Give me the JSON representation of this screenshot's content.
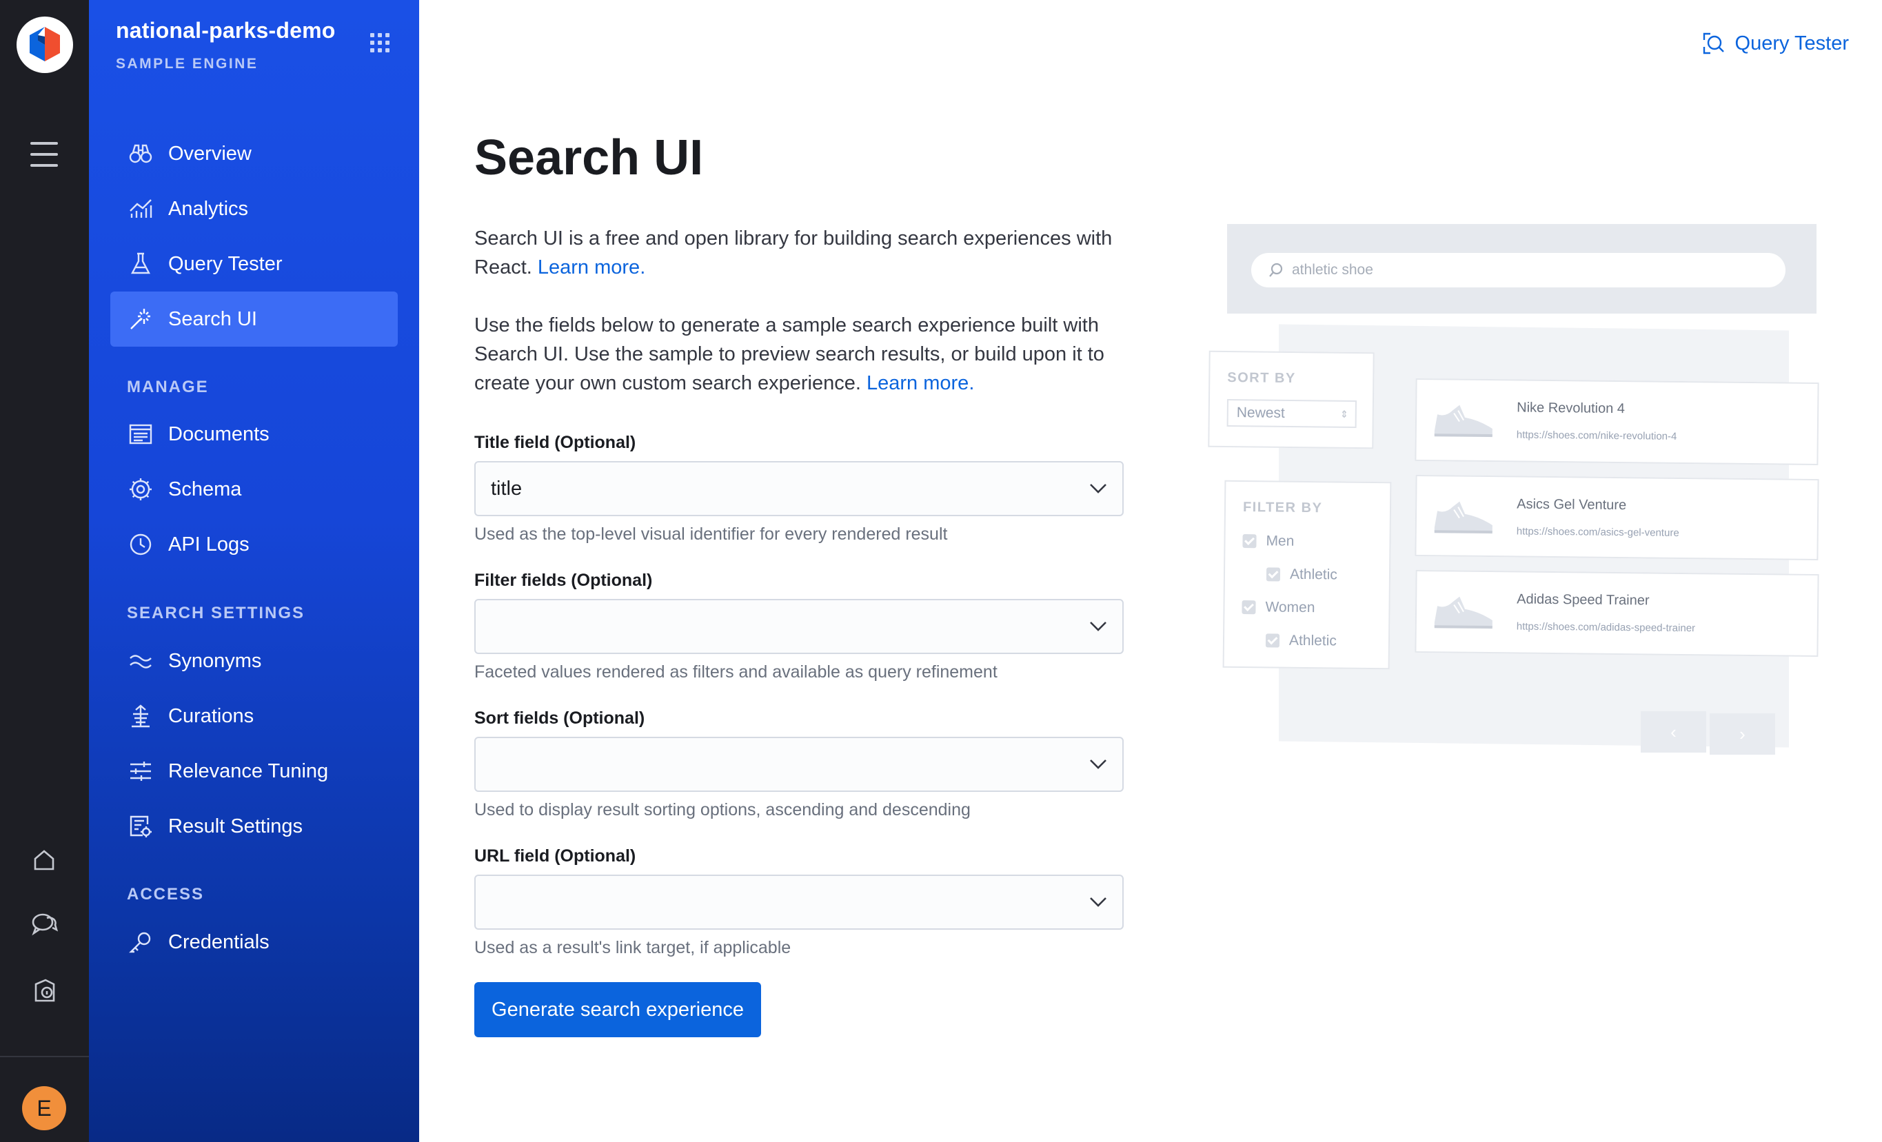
{
  "rail": {
    "avatar_letter": "E"
  },
  "sidebar": {
    "engine_name": "national-parks-demo",
    "engine_subtitle": "SAMPLE ENGINE",
    "items": [
      {
        "label": "Overview",
        "icon": "binoculars-icon"
      },
      {
        "label": "Analytics",
        "icon": "analytics-chart-icon"
      },
      {
        "label": "Query Tester",
        "icon": "beaker-icon"
      },
      {
        "label": "Search UI",
        "icon": "magic-wand-icon",
        "active": true
      }
    ],
    "manage_heading": "MANAGE",
    "manage_items": [
      {
        "label": "Documents",
        "icon": "documents-icon"
      },
      {
        "label": "Schema",
        "icon": "gear-icon"
      },
      {
        "label": "API Logs",
        "icon": "clock-icon"
      }
    ],
    "search_settings_heading": "SEARCH SETTINGS",
    "search_settings_items": [
      {
        "label": "Synonyms",
        "icon": "synonyms-wave-icon"
      },
      {
        "label": "Curations",
        "icon": "curations-icon"
      },
      {
        "label": "Relevance Tuning",
        "icon": "sliders-icon"
      },
      {
        "label": "Result Settings",
        "icon": "result-settings-icon"
      }
    ],
    "access_heading": "ACCESS",
    "access_items": [
      {
        "label": "Credentials",
        "icon": "key-icon"
      }
    ]
  },
  "header": {
    "query_tester_link": "Query Tester"
  },
  "main": {
    "title": "Search UI",
    "intro_text": "Search UI is a free and open library for building search experiences with React.",
    "intro_link": "Learn more.",
    "description_text": "Use the fields below to generate a sample search experience built with Search UI. Use the sample to preview search results, or build upon it to create your own custom search experience.",
    "description_link": "Learn more.",
    "fields": [
      {
        "label": "Title field (Optional)",
        "value": "title",
        "help": "Used as the top-level visual identifier for every rendered result"
      },
      {
        "label": "Filter fields (Optional)",
        "value": "",
        "help": "Faceted values rendered as filters and available as query refinement"
      },
      {
        "label": "Sort fields (Optional)",
        "value": "",
        "help": "Used to display result sorting options, ascending and descending"
      },
      {
        "label": "URL field (Optional)",
        "value": "",
        "help": "Used as a result's link target, if applicable"
      }
    ],
    "generate_button": "Generate search experience"
  },
  "illustration": {
    "search_query": "athletic shoe",
    "sort_label": "SORT BY",
    "sort_value": "Newest",
    "filter_label": "FILTER BY",
    "filters": [
      {
        "label": "Men",
        "indent": false
      },
      {
        "label": "Athletic",
        "indent": true
      },
      {
        "label": "Women",
        "indent": false
      },
      {
        "label": "Athletic",
        "indent": true
      }
    ],
    "results": [
      {
        "title": "Nike Revolution 4",
        "url": "https://shoes.com/nike-revolution-4"
      },
      {
        "title": "Asics Gel Venture",
        "url": "https://shoes.com/asics-gel-venture"
      },
      {
        "title": "Adidas Speed Trainer",
        "url": "https://shoes.com/adidas-speed-trainer"
      }
    ],
    "prev_glyph": "‹",
    "next_glyph": "›"
  },
  "colors": {
    "sidebar_blue": "#1a50e6",
    "active_item": "#3c6cf5",
    "primary": "#0b64dd",
    "avatar": "#f18f3b",
    "rail": "#1d1e24"
  }
}
